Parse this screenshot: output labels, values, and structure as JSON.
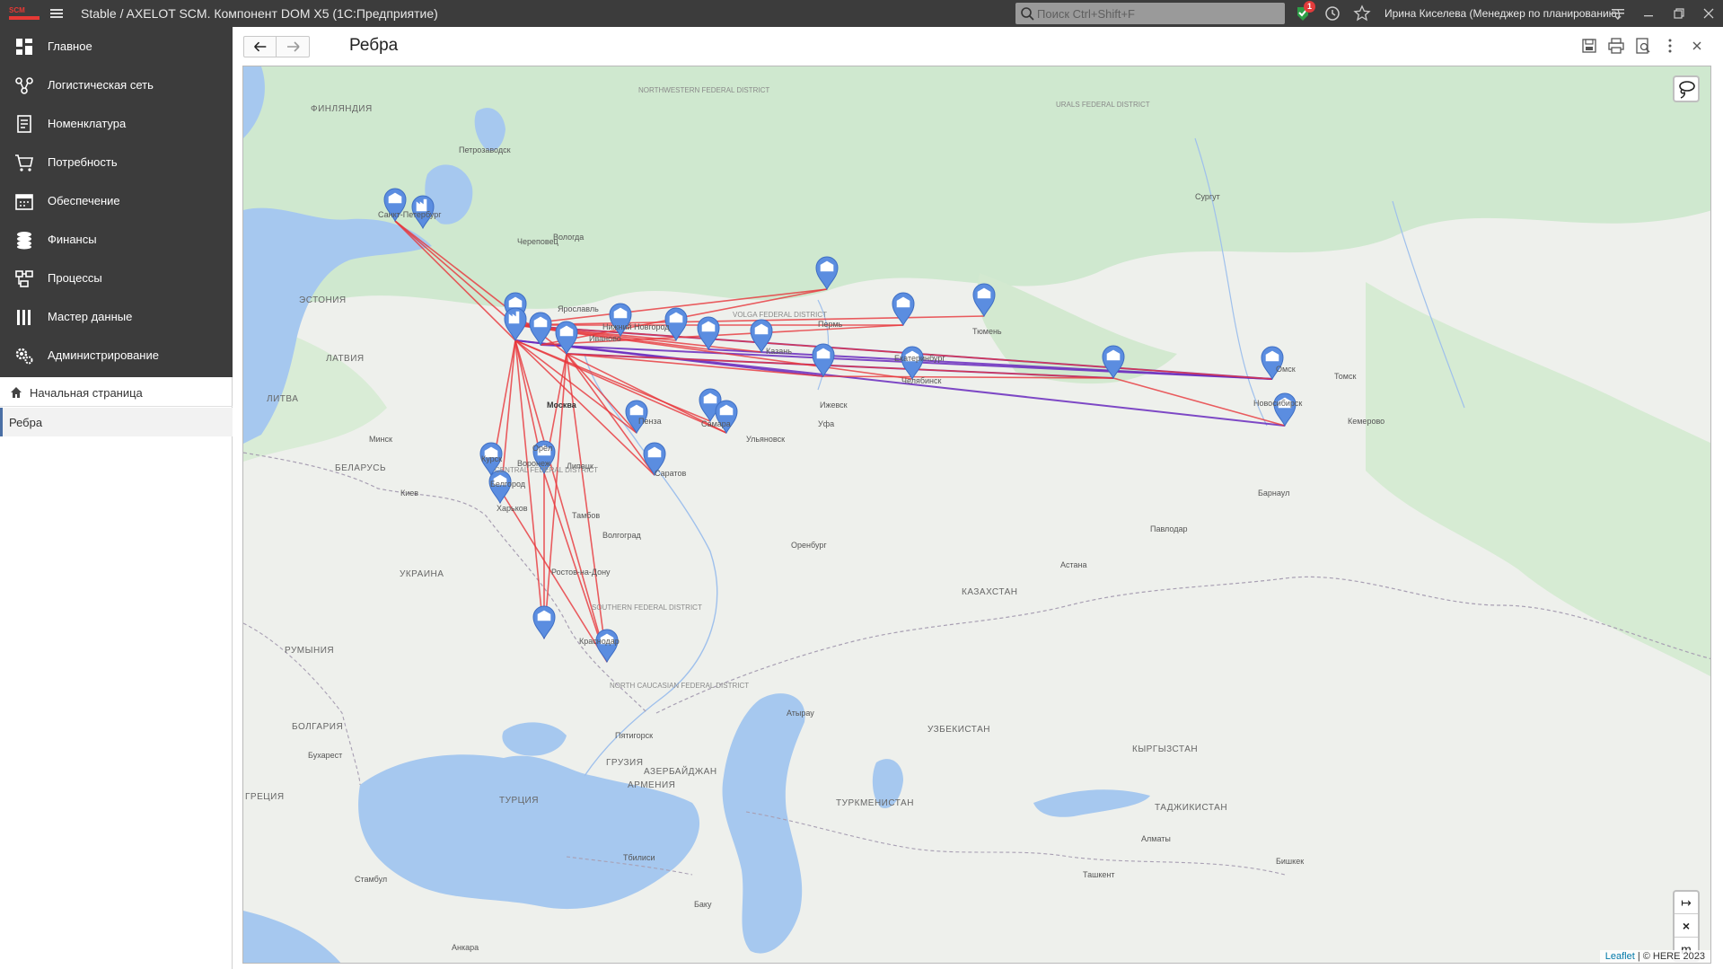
{
  "app": {
    "title": "Stable / AXELOT SCM. Компонент DOM X5  (1С:Предприятие)",
    "search_placeholder": "Поиск Ctrl+Shift+F",
    "notifications_count": "1",
    "user": "Ирина Киселева (Менеджер по планированию)",
    "icons": [
      "menu-icon",
      "search-icon",
      "notification-icon",
      "history-icon",
      "favorites-star-icon",
      "settings-menu-icon",
      "minimize-icon",
      "restore-icon",
      "close-icon"
    ]
  },
  "sections": [
    {
      "label": "Главное",
      "icon": "dashboard-icon"
    },
    {
      "label": "Логистическая сеть",
      "icon": "network-icon"
    },
    {
      "label": "Номенклатура",
      "icon": "catalog-icon"
    },
    {
      "label": "Потребность",
      "icon": "cart-icon"
    },
    {
      "label": "Обеспечение",
      "icon": "calendar-icon"
    },
    {
      "label": "Финансы",
      "icon": "coins-icon"
    },
    {
      "label": "Процессы",
      "icon": "process-icon"
    },
    {
      "label": "Мастер данные",
      "icon": "master-data-icon"
    },
    {
      "label": "Администрирование",
      "icon": "gears-icon"
    }
  ],
  "nav": {
    "home": "Начальная страница",
    "current": "Ребра"
  },
  "page": {
    "title": "Ребра",
    "tools": [
      "save-icon",
      "print-icon",
      "preview-icon",
      "more-icon",
      "close-icon"
    ]
  },
  "map": {
    "attribution_link": "Leaflet",
    "attribution_text": " | © HERE 2023",
    "zoom_buttons": [
      "↦",
      "×",
      "m"
    ],
    "edge_colors": {
      "outbound": "#e8363b",
      "inbound": "#6a2bbf"
    },
    "marker_color": "#5b8de0",
    "labels": {
      "countries": [
        "ЭСТОНИЯ",
        "ЛАТВИЯ",
        "ЛИТВА",
        "БЕЛАРУСЬ",
        "УКРАИНА",
        "РУМЫНИЯ",
        "БОЛГАРИЯ",
        "ГРЕЦИЯ",
        "ТУРЦИЯ",
        "ГРУЗИЯ",
        "АРМЕНИЯ",
        "АЗЕРБАЙДЖАН",
        "КАЗАХСТАН",
        "УЗБЕКИСТАН",
        "ТУРКМЕНИСТАН",
        "КЫРГЫЗСТАН",
        "ТАДЖИКИСТАН",
        "ФИНЛЯНДИЯ"
      ],
      "regions": [
        "NORTHWESTERN FEDERAL DISTRICT",
        "URALS FEDERAL DISTRICT",
        "VOLGA FEDERAL DISTRICT",
        "CENTRAL FEDERAL DISTRICT",
        "SOUTHERN FEDERAL DISTRICT",
        "NORTH CAUCASIAN FEDERAL DISTRICT"
      ],
      "cities": [
        "Москва",
        "Санкт-Петербург",
        "Пермь",
        "Екатеринбург",
        "Тюмень",
        "Омск",
        "Новосибирск",
        "Челябинск",
        "Самара",
        "Саратов",
        "Пенза",
        "Воронеж",
        "Курск",
        "Белгород",
        "Ростов-на-Дону",
        "Краснодар",
        "Казань",
        "Нижний Новгород",
        "Ярославль",
        "Иваново",
        "Уфа",
        "Волгоград",
        "Харьков",
        "Киев",
        "Минск",
        "Вологда",
        "Череповец",
        "Петрозаводск",
        "Сургут",
        "Томск",
        "Кемерово",
        "Барнаул",
        "Павлодар",
        "Астана",
        "Оренбург",
        "Атырау",
        "Алматы",
        "Бишкек",
        "Ташкент",
        "Тбилиси",
        "Баку",
        "Анкара",
        "Бухарест",
        "Стамбул",
        "Ижевск",
        "Тамбов",
        "Липецк",
        "Орёл",
        "Ульяновск",
        "Пятигорск"
      ]
    }
  }
}
